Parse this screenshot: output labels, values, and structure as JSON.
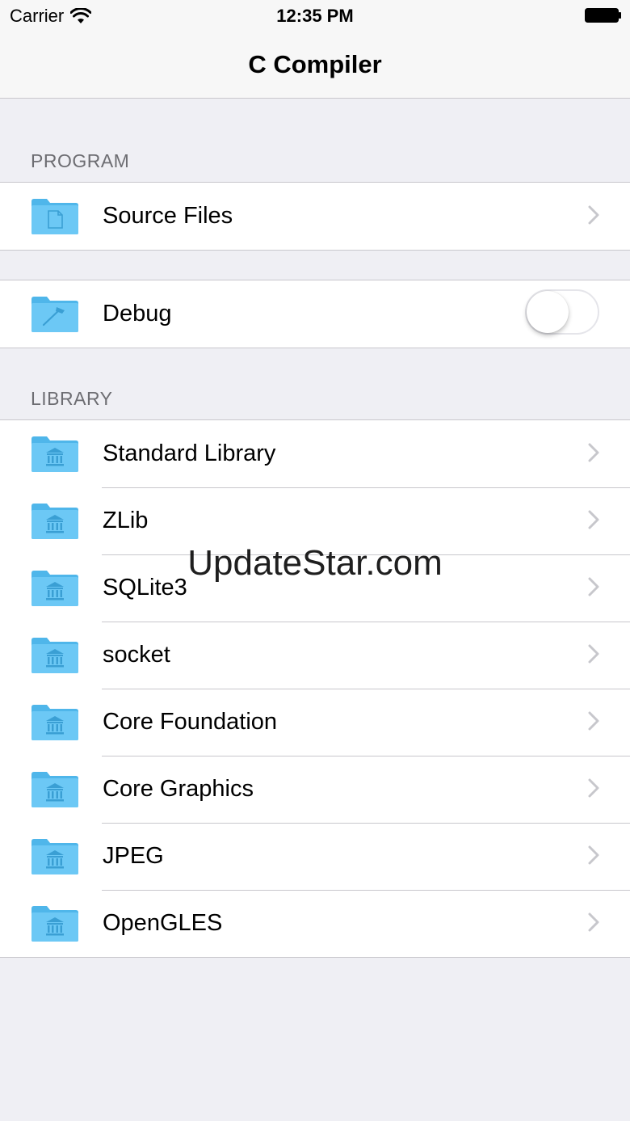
{
  "status_bar": {
    "carrier": "Carrier",
    "time": "12:35 PM",
    "icons": [
      "wifi-icon",
      "battery-icon"
    ]
  },
  "nav": {
    "title": "C Compiler"
  },
  "colors": {
    "folder": "#6cc8f5",
    "folder_dark": "#4fb6ea",
    "background": "#efeff4",
    "separator": "#c8c7cc",
    "section_header": "#6d6d72"
  },
  "sections": {
    "program": {
      "header": "PROGRAM",
      "items": [
        {
          "label": "Source Files",
          "icon": "folder-document-icon",
          "accessory": "chevron"
        }
      ]
    },
    "debug": {
      "items": [
        {
          "label": "Debug",
          "icon": "folder-hammer-icon",
          "accessory": "toggle",
          "toggle_on": false
        }
      ]
    },
    "library": {
      "header": "LIBRARY",
      "items": [
        {
          "label": "Standard Library",
          "icon": "folder-library-icon"
        },
        {
          "label": "ZLib",
          "icon": "folder-library-icon"
        },
        {
          "label": "SQLite3",
          "icon": "folder-library-icon"
        },
        {
          "label": "socket",
          "icon": "folder-library-icon"
        },
        {
          "label": "Core Foundation",
          "icon": "folder-library-icon"
        },
        {
          "label": "Core Graphics",
          "icon": "folder-library-icon"
        },
        {
          "label": "JPEG",
          "icon": "folder-library-icon"
        },
        {
          "label": "OpenGLES",
          "icon": "folder-library-icon"
        }
      ]
    }
  },
  "watermark": "UpdateStar.com"
}
